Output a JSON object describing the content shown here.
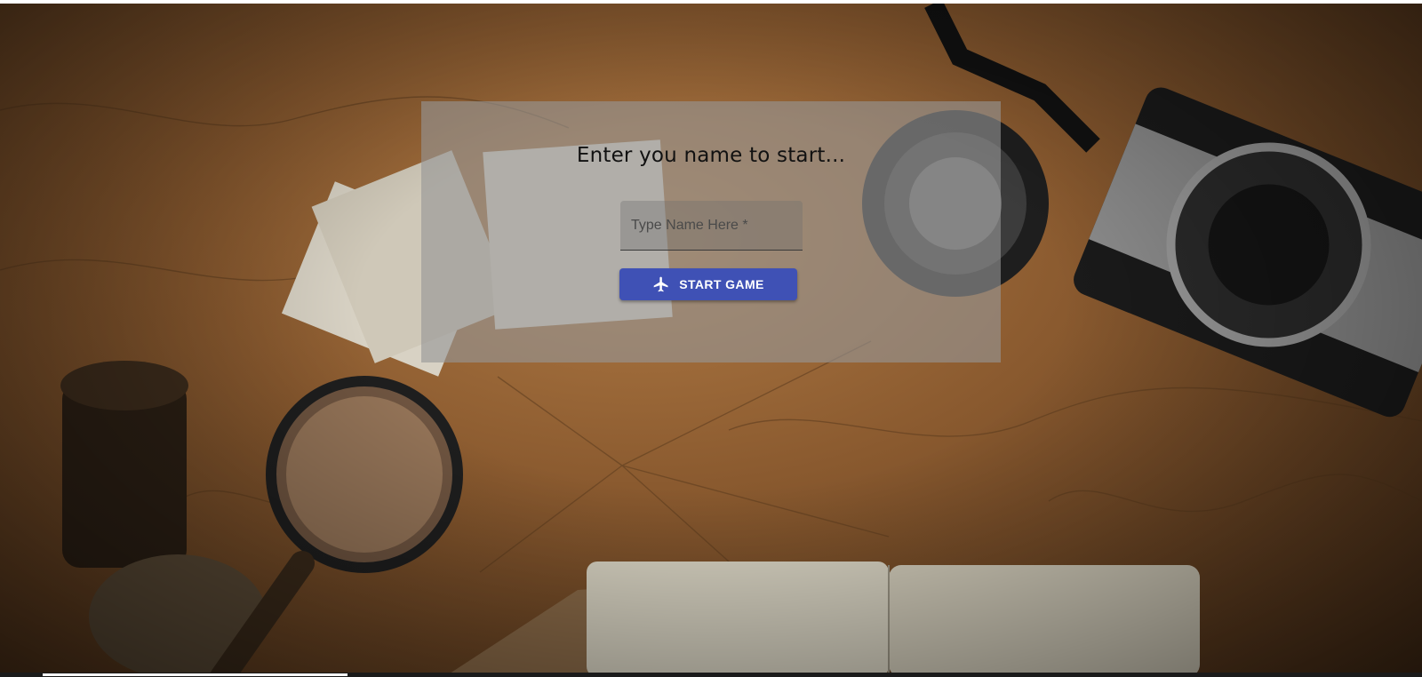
{
  "background": {
    "description_icon": "travel-map-photo"
  },
  "start_panel": {
    "title": "Enter you name to start...",
    "name_field": {
      "placeholder": "Type Name Here *",
      "value": ""
    },
    "start_button": {
      "label": "START GAME",
      "icon": "airplane-icon",
      "color": "#3f51b5"
    }
  }
}
